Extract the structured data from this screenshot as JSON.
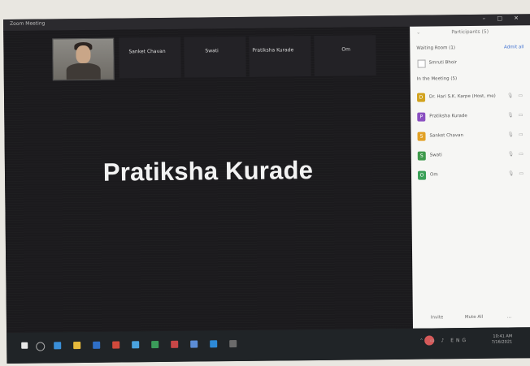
{
  "window": {
    "title": "Zoom Meeting",
    "controls": "– □ ✕"
  },
  "stage": {
    "thumbnails": [
      {
        "name": "Sanket Chavan",
        "has_video": true
      },
      {
        "name": "Swati"
      },
      {
        "name": "Pratiksha Kurade"
      },
      {
        "name": "Om"
      }
    ],
    "active_speaker": "Pratiksha Kurade"
  },
  "participants_panel": {
    "title": "Participants (5)",
    "waiting_room_label": "Waiting Room (1)",
    "admit_label": "Admit all",
    "waiting": [
      {
        "name": "Smruti Bhoir"
      }
    ],
    "in_meeting_label": "In the Meeting (5)",
    "participants": [
      {
        "name": "Dr. Hari S.K. Karpe (Host, me)",
        "avatar_color": "#d2a31f",
        "icons": "🎙 ▭"
      },
      {
        "name": "Pratiksha Kurade",
        "avatar_color": "#8a4fc1",
        "icons": "🎙 ▭"
      },
      {
        "name": "Sanket Chavan",
        "avatar_color": "#e2a126",
        "icons": "🎙 ▭"
      },
      {
        "name": "Swati",
        "avatar_color": "#3f9a4c",
        "icons": "🎙 ▭"
      },
      {
        "name": "Om",
        "avatar_color": "#3aa057",
        "icons": "🎙 ▭"
      }
    ],
    "footer": {
      "invite": "Invite",
      "mute_all": "Mute All",
      "more": "..."
    }
  },
  "taskbar": {
    "icon_colors": [
      "#3a8fd8",
      "#e6b93b",
      "#2f6fc7",
      "#d14a3c",
      "#4aa3df",
      "#3b9c5a",
      "#c84747",
      "#5c8dd6",
      "#2d8ad8",
      "#6b6b6b"
    ],
    "tray_icons": "⌃ ▭ ♪ ENG",
    "time": "10:41 AM",
    "date": "7/16/2021"
  }
}
